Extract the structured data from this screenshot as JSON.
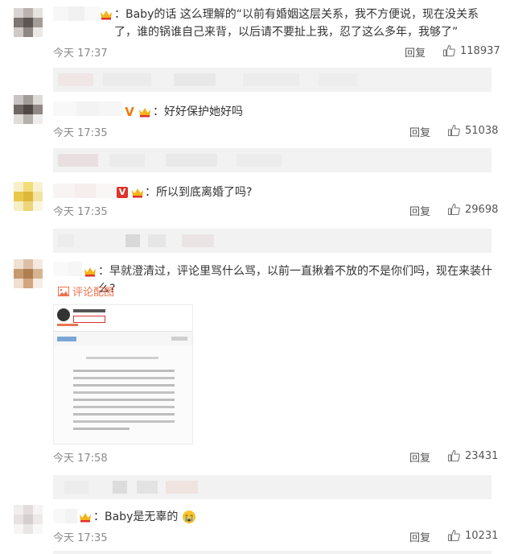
{
  "comments": [
    {
      "text": "：Baby的话 这么理解的“以前有婚姻这层关系，我不方便说，现在没关系了，谁的锅谁自己来背，以后请不要扯上我，忍了这么多年，我够了”",
      "time": "今天 17:37",
      "reply": "回复",
      "likes": "118937"
    },
    {
      "text": "：好好保护她好吗",
      "time": "今天 17:35",
      "reply": "回复",
      "likes": "51038"
    },
    {
      "text": "：所以到底离婚了吗?",
      "time": "今天 17:35",
      "reply": "回复",
      "likes": "29698"
    },
    {
      "text": "：早就澄清过，评论里骂什么骂，以前一直揪着不放的不是你们吗，现在来装什么?",
      "pic_link": "评论配图",
      "time": "今天 17:58",
      "reply": "回复",
      "likes": "23431"
    },
    {
      "text": "：Baby是无辜的",
      "time": "今天 17:35",
      "reply": "回复",
      "likes": "10231"
    }
  ],
  "icons": {
    "like": "thumbs-up-icon",
    "picture": "image-icon",
    "vip": "vip-v-icon",
    "crown": "crown-badge-icon"
  },
  "colors": {
    "link": "#eb7350",
    "vip_orange": "#f2780c",
    "vip_red": "#e0322d",
    "reply_bg": "#f2f2f2",
    "meta": "#8a8a8a"
  }
}
